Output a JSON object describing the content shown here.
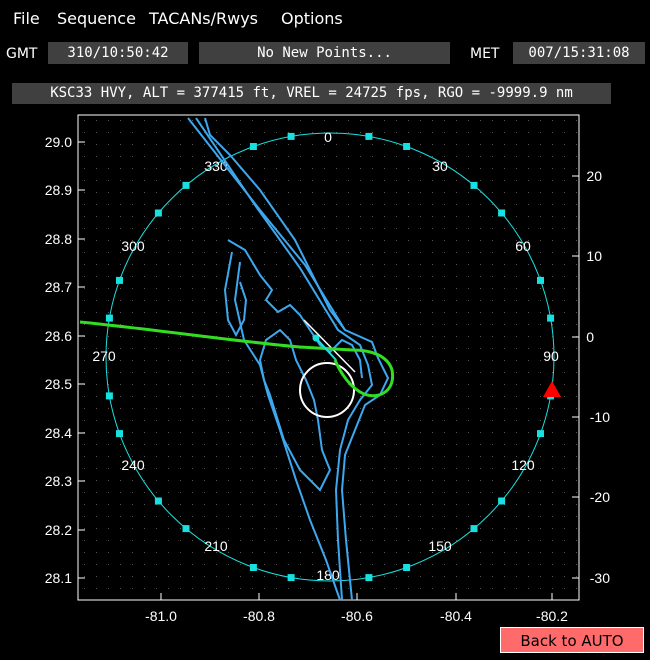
{
  "menu": {
    "file": "File",
    "sequence": "Sequence",
    "tacans": "TACANs/Rwys",
    "options": "Options"
  },
  "info": {
    "gmt_label": "GMT",
    "gmt_value": "310/10:50:42",
    "message": "No New Points...",
    "met_label": "MET",
    "met_value": "007/15:31:08"
  },
  "status_line": "KSC33 HVY, ALT = 377415 ft, VREL = 24725 fps, RGO = -9999.9 nm",
  "map": {
    "x_ticks": [
      "-81.0",
      "-80.8",
      "-80.6",
      "-80.4",
      "-80.2"
    ],
    "y_left_ticks": [
      "29.0",
      "28.9",
      "28.8",
      "28.7",
      "28.6",
      "28.5",
      "28.4",
      "28.3",
      "28.2",
      "28.1"
    ],
    "y_right_ticks": [
      "20",
      "10",
      "0",
      "-10",
      "-20",
      "-30"
    ],
    "compass_labels": [
      "0",
      "30",
      "60",
      "90",
      "120",
      "150",
      "180",
      "210",
      "240",
      "270",
      "300",
      "330"
    ],
    "colors": {
      "coast": "#3da8f0",
      "track": "#33dd22",
      "range_ring": "#19e0e0",
      "vehicle": "#ff0000",
      "hac": "#ffffff"
    }
  },
  "button": {
    "back_to_auto": "Back to AUTO"
  }
}
